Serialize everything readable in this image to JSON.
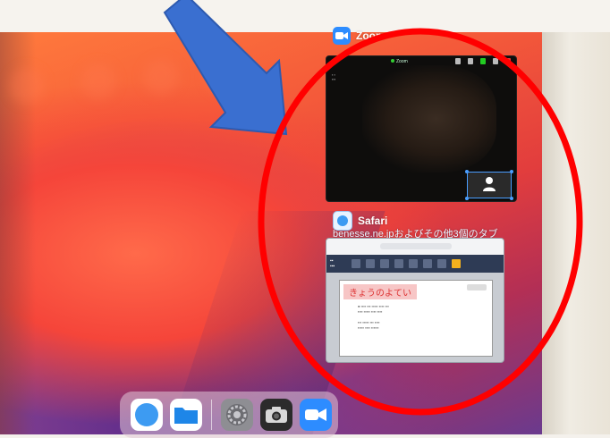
{
  "switcher": {
    "zoom": {
      "app_name": "Zoom",
      "status_text": "Zoom",
      "self_view_label": ""
    },
    "safari": {
      "app_name": "Safari",
      "subtitle": "benesse.ne.jpおよびその他3個のタブ",
      "page_heading": "きょうのよてい"
    }
  },
  "dock": {
    "apps": [
      "Safari",
      "Files",
      "Settings",
      "Camera",
      "Zoom"
    ]
  },
  "colors": {
    "annotation_arrow": "#3a6fd0",
    "annotation_circle": "#ff0000",
    "zoom_blue": "#2d8cff"
  },
  "icons": {
    "zoom": "zoom-camera-icon",
    "safari": "safari-compass-icon",
    "files": "files-folder-icon",
    "settings": "gear-icon",
    "camera": "camera-icon",
    "person": "person-icon"
  }
}
